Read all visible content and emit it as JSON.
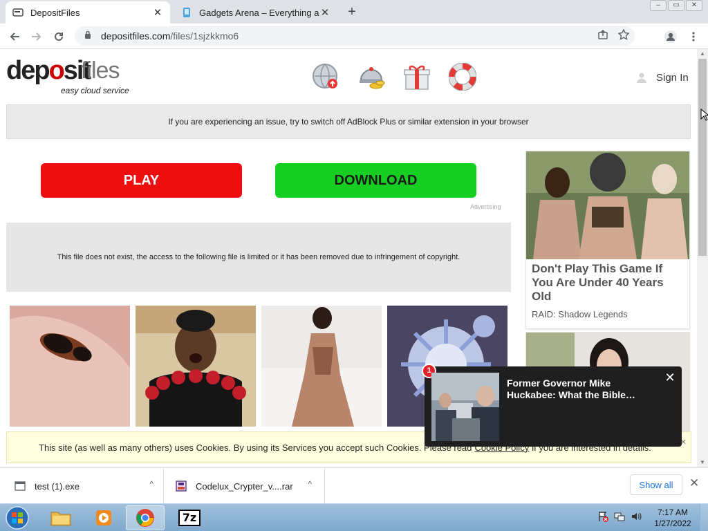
{
  "browser": {
    "tabs": [
      {
        "title": "DepositFiles",
        "close": "✕"
      },
      {
        "title": "Gadgets Arena – Everything abo",
        "close": "✕"
      }
    ],
    "new_tab": "+",
    "url_host": "depositfiles.com",
    "url_path": "/files/1sjzkkmo6",
    "window_buttons": [
      "–",
      "▭",
      "✕"
    ]
  },
  "site": {
    "logo_part1": "dep",
    "logo_part2": "o",
    "logo_part3": "sit",
    "logo_part4": "files",
    "logo_tagline": "easy cloud service",
    "top_icons": [
      "globe-upload-icon",
      "gold-coins-icon",
      "gift-icon",
      "lifebuoy-icon"
    ],
    "sign_in": "Sign In",
    "notice": "If you are experiencing an issue, try to switch off AdBlock Plus or similar extension in your browser",
    "play_label": "PLAY",
    "download_label": "DOWNLOAD",
    "advertising_label": "Advertising",
    "file_message": "This file does not exist, the access to the following file is limited or it has been removed due to infringement of copyright."
  },
  "ad_card": {
    "headline": "Don't Play This Game If You Are Under 40 Years Old",
    "source": "RAID: Shadow Legends"
  },
  "popup": {
    "badge": "1",
    "headline": "Former Governor Mike Huckabee: What the Bible…",
    "close": "✕"
  },
  "cookie": {
    "text_before": "This site (as well as many others) uses Cookies. By using its Services you accept such Cookies. Please read",
    "link": "Cookie Policy",
    "text_after": "if you are interested in details."
  },
  "downloads": {
    "items": [
      {
        "name": "test (1).exe",
        "chevron": "^"
      },
      {
        "name": "Codelux_Crypter_v....rar",
        "chevron": "^"
      }
    ],
    "show_all": "Show all",
    "close": "✕"
  },
  "taskbar": {
    "time": "7:17 AM",
    "date": "1/27/2022",
    "seven_zip": "7z"
  }
}
